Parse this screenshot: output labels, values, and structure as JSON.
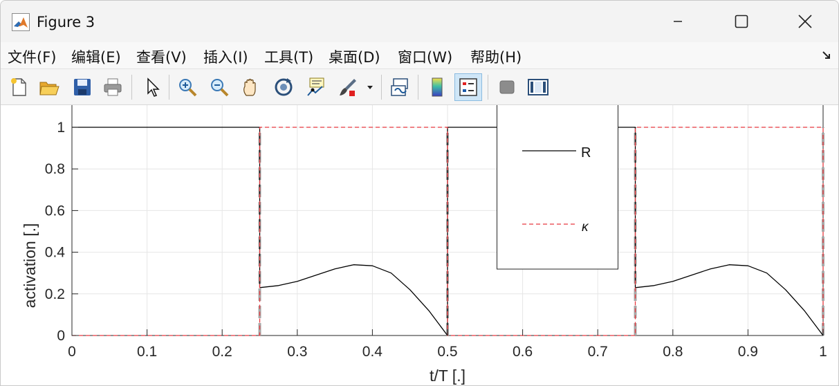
{
  "window": {
    "title": "Figure 3",
    "app_icon": "matlab-icon",
    "controls": [
      "minimize-icon",
      "maximize-icon",
      "close-icon"
    ]
  },
  "menu": {
    "items": [
      {
        "label": "文件(F)",
        "name": "menu-file"
      },
      {
        "label": "编辑(E)",
        "name": "menu-edit"
      },
      {
        "label": "查看(V)",
        "name": "menu-view"
      },
      {
        "label": "插入(I)",
        "name": "menu-insert"
      },
      {
        "label": "工具(T)",
        "name": "menu-tools"
      },
      {
        "label": "桌面(D)",
        "name": "menu-desktop"
      },
      {
        "label": "窗口(W)",
        "name": "menu-window"
      },
      {
        "label": "帮助(H)",
        "name": "menu-help"
      }
    ],
    "corner_icon": "dock-arrow-icon"
  },
  "toolbar": {
    "buttons": [
      "new-figure-icon",
      "open-file-icon",
      "save-icon",
      "print-icon",
      "edit-plot-icon",
      "zoom-in-icon",
      "zoom-out-icon",
      "pan-icon",
      "rotate-3d-icon",
      "data-cursor-icon",
      "brush-icon",
      "link-plot-icon",
      "colorbar-icon",
      "legend-icon",
      "hide-plot-tools-icon",
      "show-plot-tools-icon"
    ],
    "active": "legend-icon"
  },
  "chart_data": {
    "type": "line",
    "title": "",
    "xlabel": "t/T [.]",
    "ylabel": "activation [.]",
    "xlim": [
      0,
      1
    ],
    "ylim": [
      0,
      1.1
    ],
    "xticks": [
      0,
      0.1,
      0.2,
      0.3,
      0.4,
      0.5,
      0.6,
      0.7,
      0.8,
      0.9,
      1
    ],
    "xtick_labels": [
      "0",
      "0.1",
      "0.2",
      "0.3",
      "0.4",
      "0.5",
      "0.6",
      "0.7",
      "0.8",
      "0.9",
      "1"
    ],
    "yticks": [
      0,
      0.2,
      0.4,
      0.6,
      0.8,
      1
    ],
    "ytick_labels": [
      "0",
      "0.2",
      "0.4",
      "0.6",
      "0.8",
      "1"
    ],
    "grid": true,
    "legend_position": "top-center",
    "series": [
      {
        "name": "R",
        "color": "#000000",
        "style": "solid",
        "x": [
          0,
          0.25,
          0.25,
          0.275,
          0.3,
          0.325,
          0.35,
          0.375,
          0.4,
          0.425,
          0.45,
          0.475,
          0.5,
          0.5,
          0.75,
          0.75,
          0.775,
          0.8,
          0.825,
          0.85,
          0.875,
          0.9,
          0.925,
          0.95,
          0.975,
          1
        ],
        "y": [
          1,
          1,
          0.23,
          0.24,
          0.26,
          0.29,
          0.32,
          0.34,
          0.335,
          0.3,
          0.22,
          0.12,
          0,
          1,
          1,
          0.23,
          0.24,
          0.26,
          0.29,
          0.32,
          0.34,
          0.335,
          0.3,
          0.22,
          0.12,
          0
        ]
      },
      {
        "name": "κ",
        "color": "#e8383d",
        "style": "dashed",
        "x": [
          0,
          0.25,
          0.25,
          0.5,
          0.5,
          0.75,
          0.75,
          1,
          1
        ],
        "y": [
          0,
          0,
          1,
          1,
          0,
          0,
          1,
          1,
          0
        ]
      }
    ],
    "phase_markers": {
      "x": [
        0.25,
        0.5,
        0.75,
        1
      ],
      "color": "#a8a8a8",
      "style": "thick-dashed"
    }
  }
}
